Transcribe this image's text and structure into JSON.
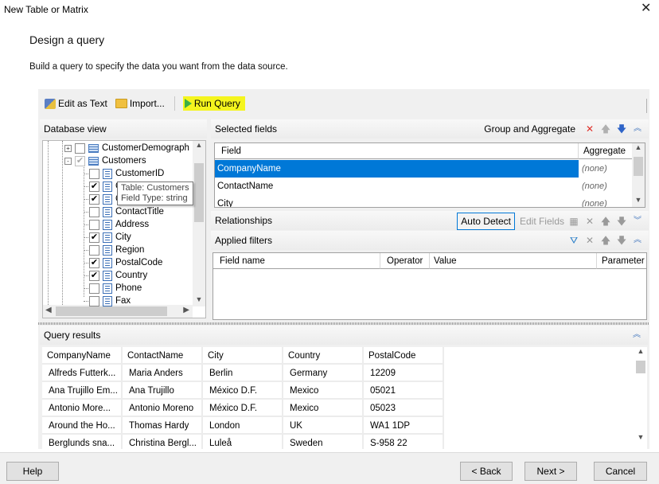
{
  "window": {
    "title": "New Table or Matrix",
    "close_icon": "close-icon"
  },
  "page": {
    "heading": "Design a query",
    "description": "Build a query to specify the data you want from the data source."
  },
  "toolbar": {
    "edit_as_text": "Edit as Text",
    "import": "Import...",
    "run_query": "Run Query",
    "highlight_color": "#f5f51e"
  },
  "database_view": {
    "label": "Database view",
    "tree": [
      {
        "label": "CustomerDemograph",
        "level": 0,
        "expander": "+",
        "checked": false,
        "type": "table"
      },
      {
        "label": "Customers",
        "level": 0,
        "expander": "-",
        "checked": true,
        "partial": true,
        "type": "table"
      },
      {
        "label": "CustomerID",
        "level": 1,
        "checked": false,
        "type": "field"
      },
      {
        "label": "CompanyName",
        "level": 1,
        "checked": true,
        "type": "field"
      },
      {
        "label": "ContactName",
        "level": 1,
        "checked": true,
        "type": "field"
      },
      {
        "label": "ContactTitle",
        "level": 1,
        "checked": false,
        "type": "field"
      },
      {
        "label": "Address",
        "level": 1,
        "checked": false,
        "type": "field"
      },
      {
        "label": "City",
        "level": 1,
        "checked": true,
        "type": "field"
      },
      {
        "label": "Region",
        "level": 1,
        "checked": false,
        "type": "field"
      },
      {
        "label": "PostalCode",
        "level": 1,
        "checked": true,
        "type": "field"
      },
      {
        "label": "Country",
        "level": 1,
        "checked": true,
        "type": "field"
      },
      {
        "label": "Phone",
        "level": 1,
        "checked": false,
        "type": "field"
      },
      {
        "label": "Fax",
        "level": 1,
        "checked": false,
        "type": "field"
      }
    ],
    "tooltip": {
      "line1": "Table: Customers",
      "line2": "Field Type: string"
    }
  },
  "selected_fields": {
    "label": "Selected fields",
    "group_aggregate": "Group and Aggregate",
    "columns": [
      "Field",
      "Aggregate"
    ],
    "rows": [
      {
        "field": "CompanyName",
        "aggregate": "(none)",
        "selected": true
      },
      {
        "field": "ContactName",
        "aggregate": "(none)",
        "selected": false
      },
      {
        "field": "City",
        "aggregate": "(none)",
        "selected": false
      }
    ],
    "selection_color": "#0078d7"
  },
  "relationships": {
    "label": "Relationships",
    "auto_detect": "Auto Detect",
    "edit_fields": "Edit Fields"
  },
  "applied_filters": {
    "label": "Applied filters",
    "columns": [
      "Field name",
      "Operator",
      "Value",
      "Parameter"
    ]
  },
  "query_results": {
    "label": "Query results",
    "columns": [
      "CompanyName",
      "ContactName",
      "City",
      "Country",
      "PostalCode"
    ],
    "rows": [
      [
        "Alfreds Futterk...",
        "Maria Anders",
        "Berlin",
        "Germany",
        "12209"
      ],
      [
        "Ana Trujillo Em...",
        "Ana Trujillo",
        "México D.F.",
        "Mexico",
        "05021"
      ],
      [
        "Antonio More...",
        "Antonio Moreno",
        "México D.F.",
        "Mexico",
        "05023"
      ],
      [
        "Around the Ho...",
        "Thomas Hardy",
        "London",
        "UK",
        "WA1 1DP"
      ],
      [
        "Berglunds sna...",
        "Christina Bergl...",
        "Luleå",
        "Sweden",
        "S-958 22"
      ]
    ]
  },
  "footer": {
    "help": "Help",
    "back": "< Back",
    "next": "Next >",
    "cancel": "Cancel"
  }
}
